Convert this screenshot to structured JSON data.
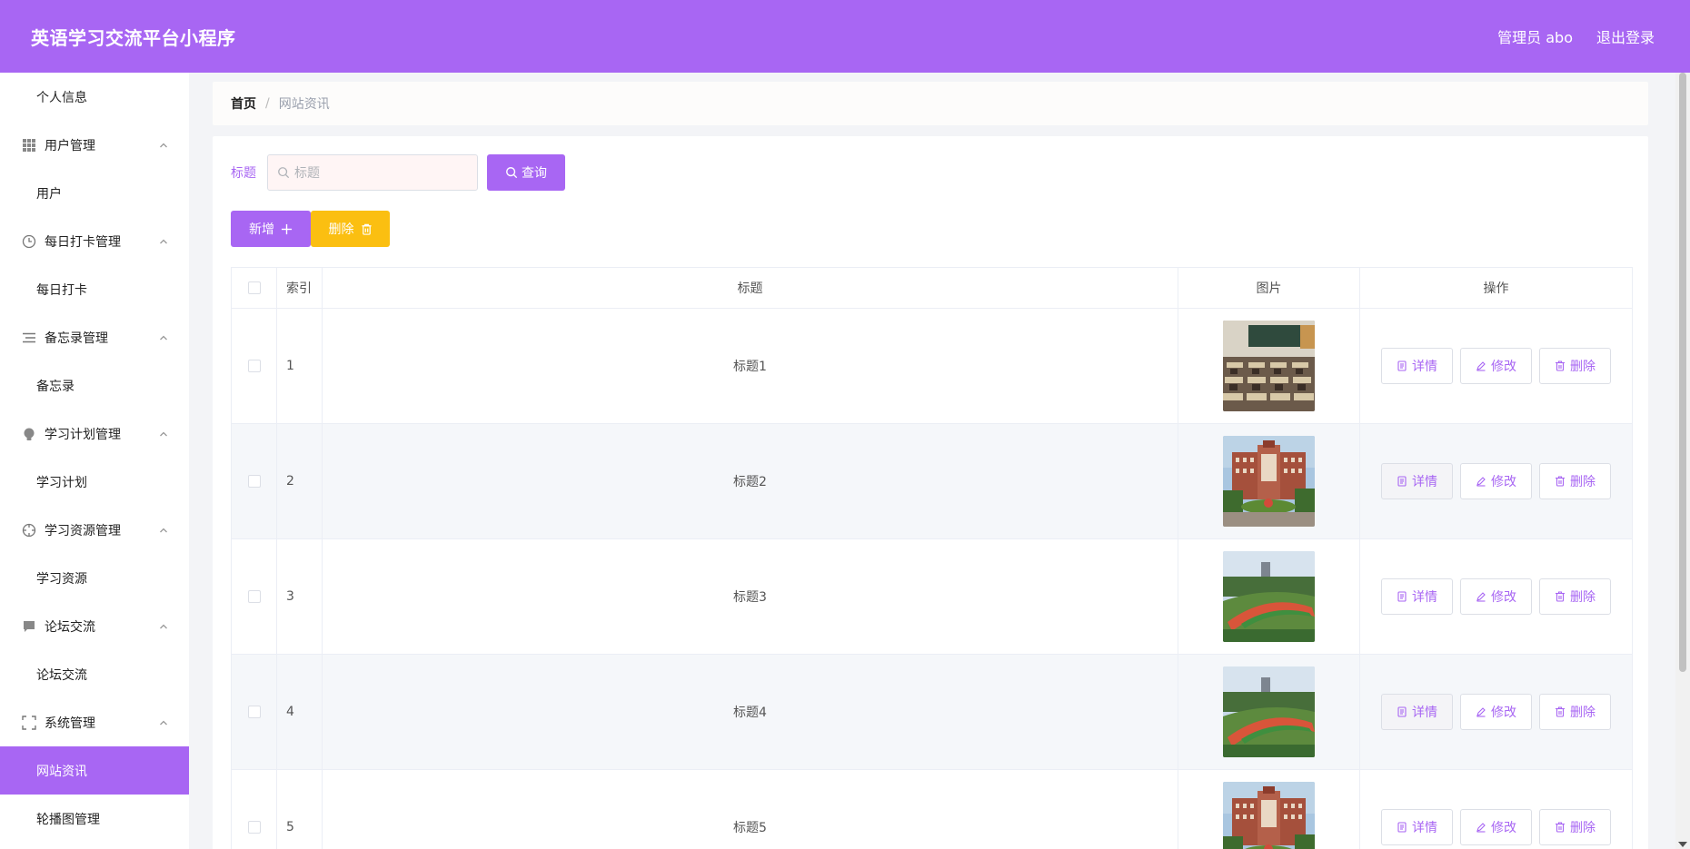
{
  "header": {
    "app_title": "英语学习交流平台小程序",
    "user_label": "管理员 abo",
    "logout_label": "退出登录"
  },
  "sidebar": {
    "items": [
      {
        "type": "sub",
        "label": "个人信息"
      },
      {
        "type": "group",
        "label": "用户管理",
        "icon": "grid-icon"
      },
      {
        "type": "sub",
        "label": "用户"
      },
      {
        "type": "group",
        "label": "每日打卡管理",
        "icon": "clock-icon"
      },
      {
        "type": "sub",
        "label": "每日打卡"
      },
      {
        "type": "group",
        "label": "备忘录管理",
        "icon": "list-icon"
      },
      {
        "type": "sub",
        "label": "备忘录"
      },
      {
        "type": "group",
        "label": "学习计划管理",
        "icon": "bulb-icon"
      },
      {
        "type": "sub",
        "label": "学习计划"
      },
      {
        "type": "group",
        "label": "学习资源管理",
        "icon": "compass-icon"
      },
      {
        "type": "sub",
        "label": "学习资源"
      },
      {
        "type": "group",
        "label": "论坛交流",
        "icon": "message-icon"
      },
      {
        "type": "sub",
        "label": "论坛交流"
      },
      {
        "type": "group",
        "label": "系统管理",
        "icon": "fullscreen-icon"
      },
      {
        "type": "sub",
        "label": "网站资讯",
        "active": true
      },
      {
        "type": "sub",
        "label": "轮播图管理"
      }
    ]
  },
  "breadcrumb": {
    "home": "首页",
    "separator": "/",
    "current": "网站资讯"
  },
  "search": {
    "label": "标题",
    "placeholder": "标题",
    "query_label": "查询"
  },
  "actions": {
    "add_label": "新增",
    "delete_label": "删除"
  },
  "table": {
    "columns": [
      "索引",
      "标题",
      "图片",
      "操作"
    ],
    "rows": [
      {
        "index": "1",
        "title": "标题1",
        "image": "classroom"
      },
      {
        "index": "2",
        "title": "标题2",
        "image": "building"
      },
      {
        "index": "3",
        "title": "标题3",
        "image": "track"
      },
      {
        "index": "4",
        "title": "标题4",
        "image": "track"
      },
      {
        "index": "5",
        "title": "标题5",
        "image": "building"
      }
    ],
    "op_labels": {
      "detail": "详情",
      "edit": "修改",
      "delete": "删除"
    }
  },
  "colors": {
    "accent": "#a866f3",
    "warning": "#fbbf11"
  }
}
